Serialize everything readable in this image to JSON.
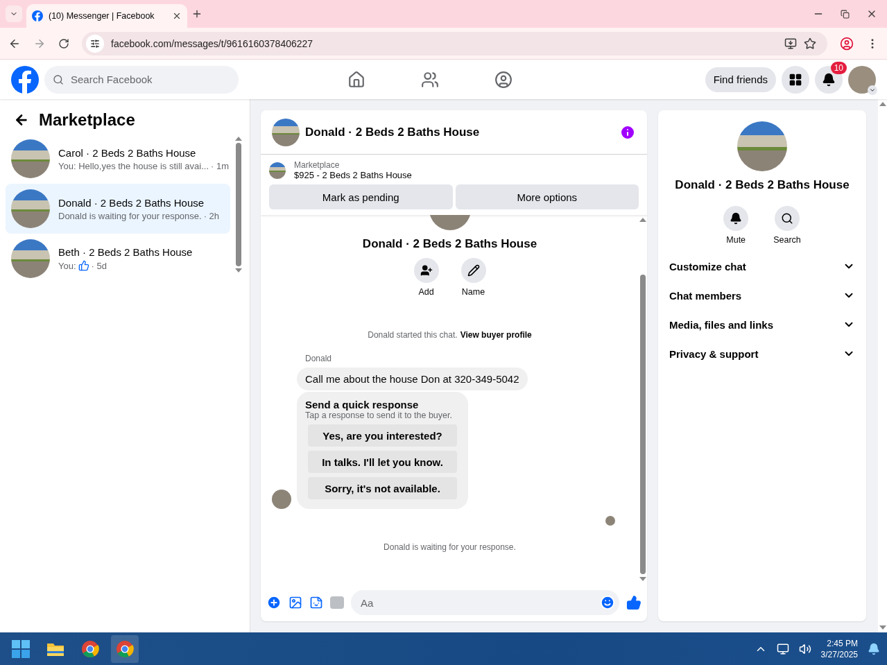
{
  "browser": {
    "tab_title": "(10) Messenger | Facebook",
    "url": "facebook.com/messages/t/9616160378406227"
  },
  "header": {
    "search_placeholder": "Search Facebook",
    "find_friends": "Find friends",
    "notification_count": "10"
  },
  "sidebar": {
    "title": "Marketplace",
    "conversations": [
      {
        "kind": "text",
        "name": "Carol · 2 Beds 2 Baths House",
        "preview": "You: Hello,yes the house is still avai...",
        "time": "· 1m",
        "selected": false
      },
      {
        "kind": "text",
        "name": "Donald · 2 Beds 2 Baths House",
        "preview": "Donald is waiting for your response.",
        "time": "· 2h",
        "selected": true
      },
      {
        "kind": "like",
        "name": "Beth · 2 Beds 2 Baths House",
        "preview": "You:",
        "time": "· 5d",
        "selected": false
      }
    ]
  },
  "chat": {
    "title": "Donald · 2 Beds 2 Baths House",
    "listing": {
      "label": "Marketplace",
      "title": "$925 - 2 Beds 2 Baths House"
    },
    "actions": [
      "Mark as pending",
      "More options"
    ],
    "profile_name": "Donald · 2 Beds 2 Baths House",
    "profile_actions": [
      {
        "kind": "add",
        "label": "Add"
      },
      {
        "kind": "name",
        "label": "Name"
      }
    ],
    "started_text": "Donald started this chat.",
    "buyer_profile_link": "View buyer profile",
    "sender": "Donald",
    "message": "Call me about the house Don at 320-349-5042",
    "quick_response": {
      "title": "Send a quick response",
      "subtitle": "Tap a response to send it to the buyer.",
      "options": [
        "Yes, are you interested?",
        "In talks. I'll let you know.",
        "Sorry, it's not available."
      ]
    },
    "status": "Donald is waiting for your response.",
    "composer_placeholder": "Aa"
  },
  "details": {
    "name": "Donald · 2 Beds 2 Baths House",
    "actions": [
      {
        "kind": "mute",
        "label": "Mute"
      },
      {
        "kind": "search",
        "label": "Search"
      }
    ],
    "sections": [
      "Customize chat",
      "Chat members",
      "Media, files and links",
      "Privacy & support"
    ]
  },
  "taskbar": {
    "time": "2:45 PM",
    "date": "3/27/2025"
  }
}
